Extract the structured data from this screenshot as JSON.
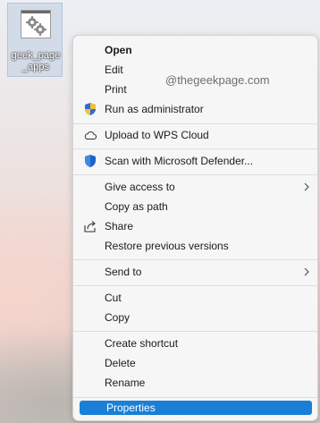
{
  "desktop": {
    "icon_label": "geek_page_apps"
  },
  "watermark": "@thegeekpage.com",
  "menu": {
    "items": [
      {
        "label": "Open",
        "icon": "none"
      },
      {
        "label": "Edit",
        "icon": "none"
      },
      {
        "label": "Print",
        "icon": "none"
      },
      {
        "label": "Run as administrator",
        "icon": "uac-shield-icon"
      },
      {
        "label": "Upload to WPS Cloud",
        "icon": "cloud-icon"
      },
      {
        "label": "Scan with Microsoft Defender...",
        "icon": "defender-shield-icon"
      },
      {
        "label": "Give access to",
        "icon": "none",
        "submenu": true
      },
      {
        "label": "Copy as path",
        "icon": "none"
      },
      {
        "label": "Share",
        "icon": "share-icon"
      },
      {
        "label": "Restore previous versions",
        "icon": "none"
      },
      {
        "label": "Send to",
        "icon": "none",
        "submenu": true
      },
      {
        "label": "Cut",
        "icon": "none"
      },
      {
        "label": "Copy",
        "icon": "none"
      },
      {
        "label": "Create shortcut",
        "icon": "none"
      },
      {
        "label": "Delete",
        "icon": "none"
      },
      {
        "label": "Rename",
        "icon": "none"
      },
      {
        "label": "Properties",
        "icon": "none",
        "selected": true
      }
    ]
  },
  "colors": {
    "selection": "#1a7fd6",
    "menu_bg": "#f6f6f6",
    "defender_blue": "#1e63c6"
  }
}
